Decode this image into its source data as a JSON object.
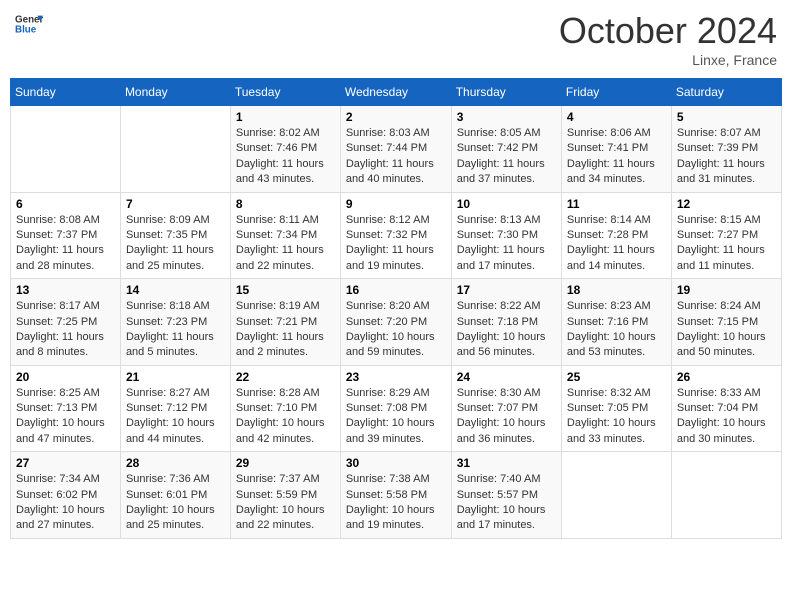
{
  "header": {
    "logo_line1": "General",
    "logo_line2": "Blue",
    "month": "October 2024",
    "location": "Linxe, France"
  },
  "weekdays": [
    "Sunday",
    "Monday",
    "Tuesday",
    "Wednesday",
    "Thursday",
    "Friday",
    "Saturday"
  ],
  "weeks": [
    [
      {
        "day": "",
        "info": ""
      },
      {
        "day": "",
        "info": ""
      },
      {
        "day": "1",
        "info": "Sunrise: 8:02 AM\nSunset: 7:46 PM\nDaylight: 11 hours and 43 minutes."
      },
      {
        "day": "2",
        "info": "Sunrise: 8:03 AM\nSunset: 7:44 PM\nDaylight: 11 hours and 40 minutes."
      },
      {
        "day": "3",
        "info": "Sunrise: 8:05 AM\nSunset: 7:42 PM\nDaylight: 11 hours and 37 minutes."
      },
      {
        "day": "4",
        "info": "Sunrise: 8:06 AM\nSunset: 7:41 PM\nDaylight: 11 hours and 34 minutes."
      },
      {
        "day": "5",
        "info": "Sunrise: 8:07 AM\nSunset: 7:39 PM\nDaylight: 11 hours and 31 minutes."
      }
    ],
    [
      {
        "day": "6",
        "info": "Sunrise: 8:08 AM\nSunset: 7:37 PM\nDaylight: 11 hours and 28 minutes."
      },
      {
        "day": "7",
        "info": "Sunrise: 8:09 AM\nSunset: 7:35 PM\nDaylight: 11 hours and 25 minutes."
      },
      {
        "day": "8",
        "info": "Sunrise: 8:11 AM\nSunset: 7:34 PM\nDaylight: 11 hours and 22 minutes."
      },
      {
        "day": "9",
        "info": "Sunrise: 8:12 AM\nSunset: 7:32 PM\nDaylight: 11 hours and 19 minutes."
      },
      {
        "day": "10",
        "info": "Sunrise: 8:13 AM\nSunset: 7:30 PM\nDaylight: 11 hours and 17 minutes."
      },
      {
        "day": "11",
        "info": "Sunrise: 8:14 AM\nSunset: 7:28 PM\nDaylight: 11 hours and 14 minutes."
      },
      {
        "day": "12",
        "info": "Sunrise: 8:15 AM\nSunset: 7:27 PM\nDaylight: 11 hours and 11 minutes."
      }
    ],
    [
      {
        "day": "13",
        "info": "Sunrise: 8:17 AM\nSunset: 7:25 PM\nDaylight: 11 hours and 8 minutes."
      },
      {
        "day": "14",
        "info": "Sunrise: 8:18 AM\nSunset: 7:23 PM\nDaylight: 11 hours and 5 minutes."
      },
      {
        "day": "15",
        "info": "Sunrise: 8:19 AM\nSunset: 7:21 PM\nDaylight: 11 hours and 2 minutes."
      },
      {
        "day": "16",
        "info": "Sunrise: 8:20 AM\nSunset: 7:20 PM\nDaylight: 10 hours and 59 minutes."
      },
      {
        "day": "17",
        "info": "Sunrise: 8:22 AM\nSunset: 7:18 PM\nDaylight: 10 hours and 56 minutes."
      },
      {
        "day": "18",
        "info": "Sunrise: 8:23 AM\nSunset: 7:16 PM\nDaylight: 10 hours and 53 minutes."
      },
      {
        "day": "19",
        "info": "Sunrise: 8:24 AM\nSunset: 7:15 PM\nDaylight: 10 hours and 50 minutes."
      }
    ],
    [
      {
        "day": "20",
        "info": "Sunrise: 8:25 AM\nSunset: 7:13 PM\nDaylight: 10 hours and 47 minutes."
      },
      {
        "day": "21",
        "info": "Sunrise: 8:27 AM\nSunset: 7:12 PM\nDaylight: 10 hours and 44 minutes."
      },
      {
        "day": "22",
        "info": "Sunrise: 8:28 AM\nSunset: 7:10 PM\nDaylight: 10 hours and 42 minutes."
      },
      {
        "day": "23",
        "info": "Sunrise: 8:29 AM\nSunset: 7:08 PM\nDaylight: 10 hours and 39 minutes."
      },
      {
        "day": "24",
        "info": "Sunrise: 8:30 AM\nSunset: 7:07 PM\nDaylight: 10 hours and 36 minutes."
      },
      {
        "day": "25",
        "info": "Sunrise: 8:32 AM\nSunset: 7:05 PM\nDaylight: 10 hours and 33 minutes."
      },
      {
        "day": "26",
        "info": "Sunrise: 8:33 AM\nSunset: 7:04 PM\nDaylight: 10 hours and 30 minutes."
      }
    ],
    [
      {
        "day": "27",
        "info": "Sunrise: 7:34 AM\nSunset: 6:02 PM\nDaylight: 10 hours and 27 minutes."
      },
      {
        "day": "28",
        "info": "Sunrise: 7:36 AM\nSunset: 6:01 PM\nDaylight: 10 hours and 25 minutes."
      },
      {
        "day": "29",
        "info": "Sunrise: 7:37 AM\nSunset: 5:59 PM\nDaylight: 10 hours and 22 minutes."
      },
      {
        "day": "30",
        "info": "Sunrise: 7:38 AM\nSunset: 5:58 PM\nDaylight: 10 hours and 19 minutes."
      },
      {
        "day": "31",
        "info": "Sunrise: 7:40 AM\nSunset: 5:57 PM\nDaylight: 10 hours and 17 minutes."
      },
      {
        "day": "",
        "info": ""
      },
      {
        "day": "",
        "info": ""
      }
    ]
  ]
}
